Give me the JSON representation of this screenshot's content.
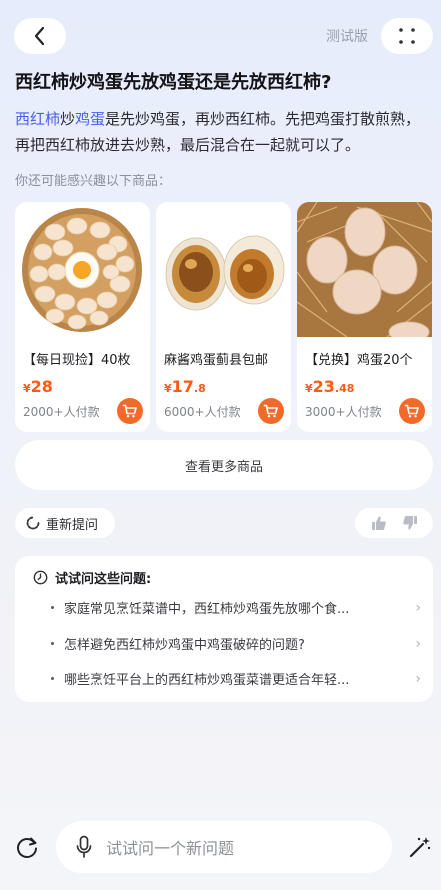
{
  "header": {
    "back_icon": "back-arrow-icon",
    "test_label": "测试版",
    "more_icon": "dots-grid-icon"
  },
  "question": {
    "title": "西红柿炒鸡蛋先放鸡蛋还是先放西红柿?"
  },
  "answer": {
    "link1": "西红柿",
    "mid1": "炒",
    "link2": "鸡蛋",
    "rest": "是先炒鸡蛋，再炒西红柿。先把鸡蛋打散煎熟，再把西红柿放进去炒熟，最后混合在一起就可以了。"
  },
  "recommend": {
    "label": "你还可能感兴趣以下商品：",
    "products": [
      {
        "name": "【每日现捡】40枚",
        "symbol": "¥",
        "price_int": "28",
        "price_dec": "",
        "sold": "2000+人付款",
        "image": "basket-of-eggs"
      },
      {
        "name": "麻酱鸡蛋蓟县包邮",
        "symbol": "¥",
        "price_int": "17",
        "price_dec": ".8",
        "sold": "6000+人付款",
        "image": "salted-eggs"
      },
      {
        "name": "【兑换】鸡蛋20个",
        "symbol": "¥",
        "price_int": "23",
        "price_dec": ".48",
        "sold": "3000+人付款",
        "image": "eggs-on-straw"
      }
    ],
    "more_label": "查看更多商品"
  },
  "actions": {
    "regen_label": "重新提问",
    "like_icon": "thumb-up-icon",
    "dislike_icon": "thumb-down-icon"
  },
  "suggestions": {
    "title": "试试问这些问题:",
    "items": [
      "家庭常见烹饪菜谱中，西红柿炒鸡蛋先放哪个食...",
      "怎样避免西红柿炒鸡蛋中鸡蛋破碎的问题?",
      "哪些烹饪平台上的西红柿炒鸡蛋菜谱更适合年轻..."
    ]
  },
  "composer": {
    "placeholder": "试试问一个新问题",
    "left_icon": "new-chat-icon",
    "mic_icon": "mic-icon",
    "right_icon": "magic-wand-icon"
  },
  "colors": {
    "accent": "#4a5ef0",
    "price": "#ff5a14",
    "cart": "#f16a2a"
  }
}
